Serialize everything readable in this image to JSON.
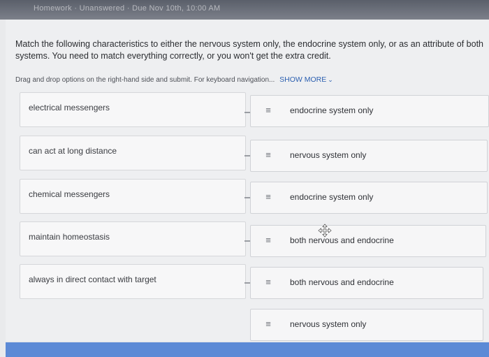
{
  "header": {
    "crumbs": "Homework · Unanswered · Due Nov 10th, 10:00 AM"
  },
  "question": {
    "prompt": "Match the following characteristics to either the nervous system only, the endocrine system only, or as an attribute of both systems. You need to match everything correctly, or you won't get the extra credit.",
    "instructions": "Drag and drop options on the right-hand side and submit. For keyboard navigation...",
    "show_more": "SHOW MORE"
  },
  "icons": {
    "drag_handle": "drag-handle-icon",
    "chevron": "chevron-down-icon",
    "cursor": "move-cursor-icon"
  },
  "colors": {
    "link": "#2b5fb0",
    "bottom_bar": "#5c8ad6"
  },
  "matching": {
    "characteristics": [
      "electrical messengers",
      "can act at long distance",
      "chemical messengers",
      "maintain homeostasis",
      "always in direct contact with target"
    ],
    "answers": [
      "endocrine system only",
      "nervous system only",
      "endocrine system only",
      "both nervous and endocrine",
      "both nervous and endocrine",
      "nervous system only"
    ]
  }
}
